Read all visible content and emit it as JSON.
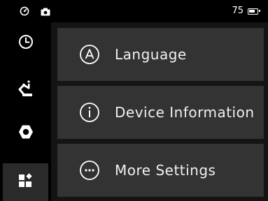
{
  "status_bar": {
    "battery_percent": "75",
    "icons": [
      "gauge-icon",
      "camera-icon",
      "battery-icon"
    ]
  },
  "sidebar": {
    "items": [
      {
        "icon": "clock-icon",
        "active": false
      },
      {
        "icon": "robot-arm-icon",
        "active": false
      },
      {
        "icon": "hexagon-nut-icon",
        "active": false
      },
      {
        "icon": "apps-grid-icon",
        "active": true
      }
    ]
  },
  "menu": {
    "items": [
      {
        "label": "Language",
        "icon": "language-a-icon"
      },
      {
        "label": "Device Information",
        "icon": "info-icon"
      },
      {
        "label": "More Settings",
        "icon": "more-dots-icon"
      }
    ]
  },
  "colors": {
    "background": "#141414",
    "sidebar": "#000000",
    "card": "#333333",
    "active_tab": "#2a2a2a",
    "foreground": "#ffffff"
  }
}
